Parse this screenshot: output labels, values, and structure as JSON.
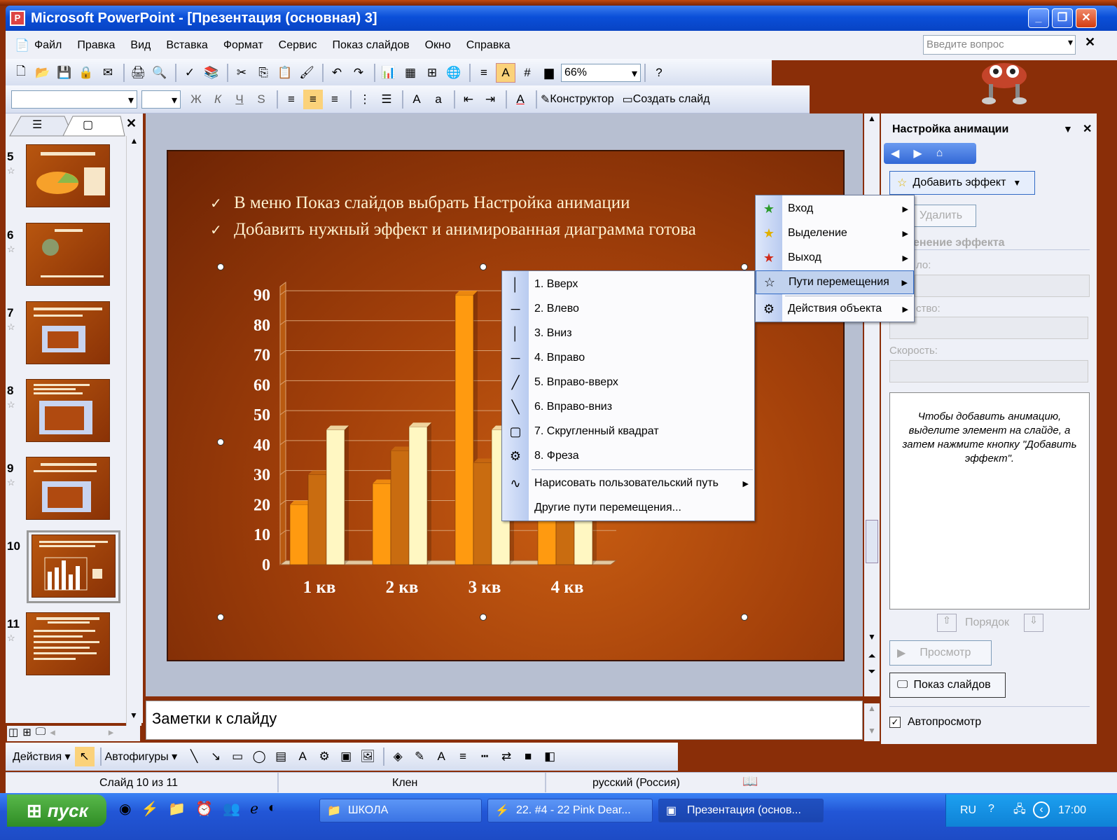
{
  "window": {
    "title": "Microsoft PowerPoint - [Презентация (основная) 3]"
  },
  "menubar": {
    "items": [
      "Файл",
      "Правка",
      "Вид",
      "Вставка",
      "Формат",
      "Сервис",
      "Показ слайдов",
      "Окно",
      "Справка"
    ],
    "help_placeholder": "Введите вопрос"
  },
  "toolbar": {
    "zoom": "66%",
    "designer": "Конструктор",
    "new_slide": "Создать слайд"
  },
  "thumbs": [
    {
      "num": "5"
    },
    {
      "num": "6"
    },
    {
      "num": "7"
    },
    {
      "num": "8"
    },
    {
      "num": "9"
    },
    {
      "num": "10"
    },
    {
      "num": "11"
    }
  ],
  "slide": {
    "bullets": [
      "В меню Показ слайдов выбрать Настройка анимации",
      "Добавить нужный эффект и анимированная диаграмма готова"
    ]
  },
  "chart_data": {
    "type": "bar",
    "categories": [
      "1 кв",
      "2 кв",
      "3 кв",
      "4 кв"
    ],
    "series": [
      {
        "values": [
          20,
          27,
          90,
          23
        ],
        "color": "#ff9a10"
      },
      {
        "values": [
          30,
          38,
          34,
          38
        ],
        "color": "#c96c10"
      },
      {
        "values": [
          45,
          46,
          45,
          45
        ],
        "color": "#fff7c2"
      }
    ],
    "ylim": [
      0,
      90
    ],
    "yticks": [
      "0",
      "10",
      "20",
      "30",
      "40",
      "50",
      "60",
      "70",
      "80",
      "90"
    ]
  },
  "notes": {
    "placeholder": "Заметки к слайду"
  },
  "taskpane": {
    "title": "Настройка анимации",
    "add_effect": "Добавить эффект",
    "delete": "Удалить",
    "change_effect": "енение эффекта",
    "start_label": "ло:",
    "property_label": "ство:",
    "speed_label": "Скорость:",
    "info": "Чтобы добавить анимацию, выделите элемент на слайде, а затем нажмите кнопку \"Добавить эффект\".",
    "order": "Порядок",
    "preview": "Просмотр",
    "slideshow": "Показ слайдов",
    "autopreview": "Автопросмотр"
  },
  "effect_menu": {
    "items": [
      {
        "label": "Вход",
        "icon": "entrance-star-icon"
      },
      {
        "label": "Выделение",
        "icon": "emphasis-star-icon"
      },
      {
        "label": "Выход",
        "icon": "exit-star-icon"
      },
      {
        "label": "Пути перемещения",
        "icon": "motion-path-star-icon"
      },
      {
        "label": "Действия объекта",
        "icon": "object-actions-icon"
      }
    ]
  },
  "path_menu": {
    "items": [
      "1. Вверх",
      "2. Влево",
      "3. Вниз",
      "4. Вправо",
      "5. Вправо-вверх",
      "6. Вправо-вниз",
      "7. Скругленный квадрат",
      "8. Фреза"
    ],
    "draw": "Нарисовать пользовательский путь",
    "other": "Другие пути перемещения..."
  },
  "drawbar": {
    "actions": "Действия",
    "autoshapes": "Автофигуры"
  },
  "statusbar": {
    "slide": "Слайд 10 из 11",
    "design": "Клен",
    "lang": "русский (Россия)"
  },
  "taskbar": {
    "start": "пуск",
    "tasks": [
      "ШКОЛА",
      "22. #4 - 22 Pink Dear...",
      "Презентация (основ..."
    ],
    "lang": "RU",
    "clock": "17:00"
  }
}
